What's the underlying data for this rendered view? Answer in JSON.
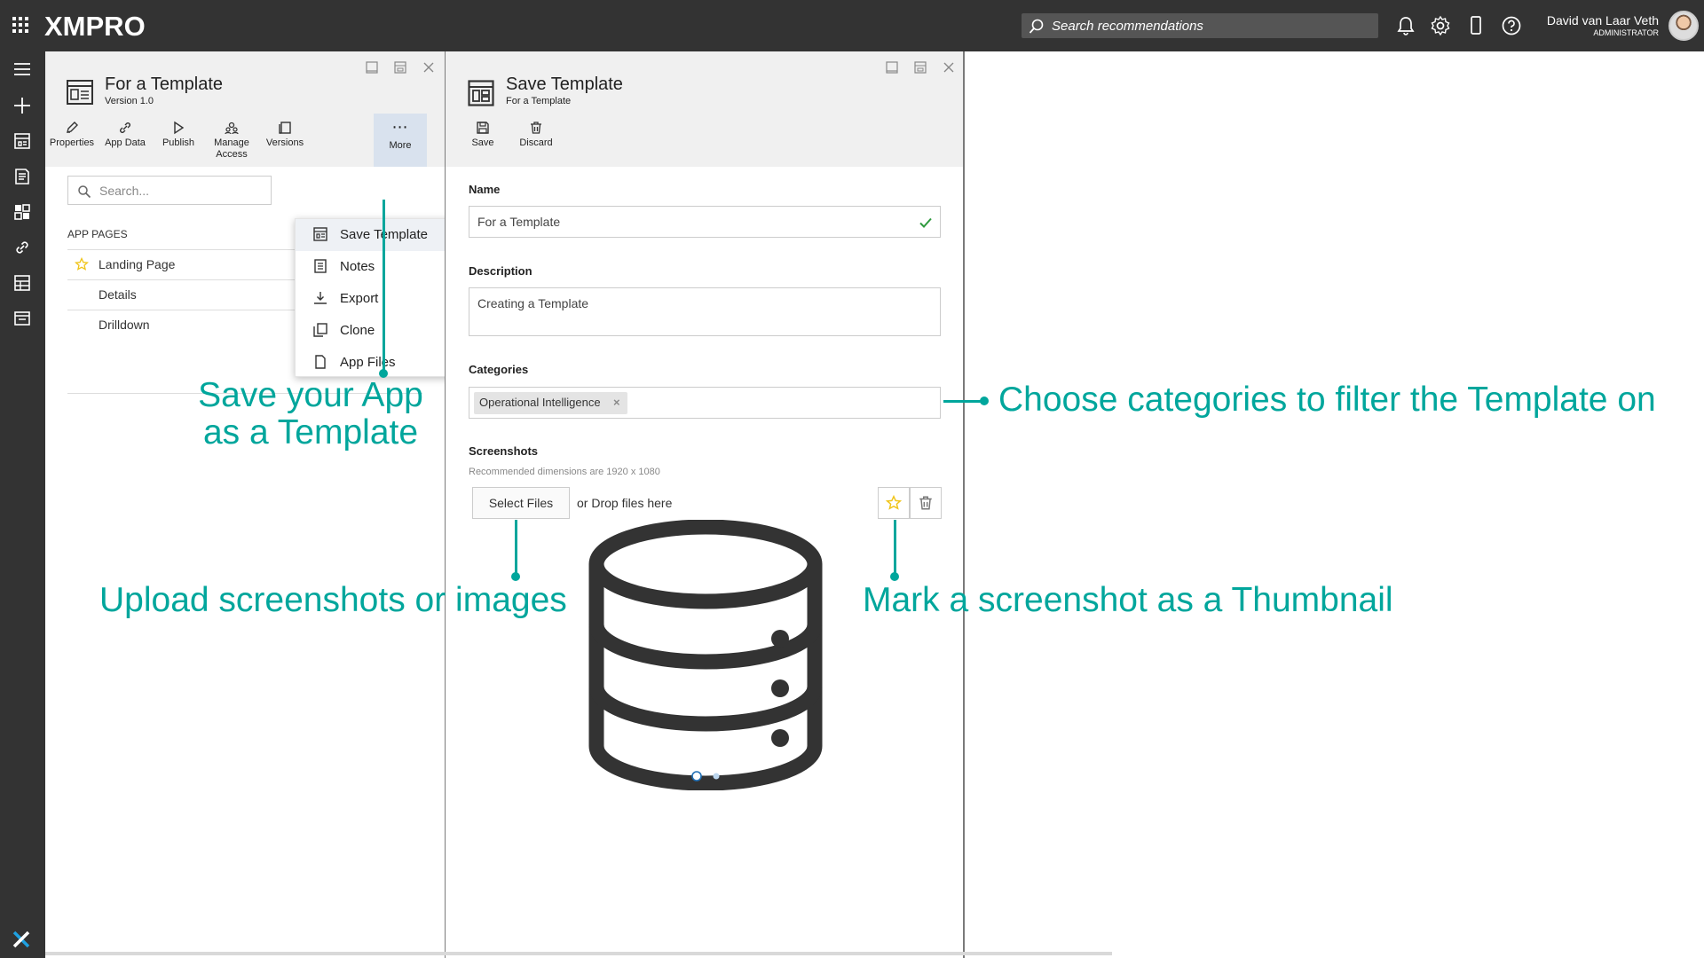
{
  "app": {
    "logo": "XMPRO",
    "search_placeholder": "Search recommendations",
    "user_name": "David van Laar Veth",
    "user_role": "ADMINISTRATOR"
  },
  "rail": {
    "icons": [
      "menu-icon",
      "plus-icon",
      "apps-list-icon",
      "recommendations-icon",
      "dashboard-icon",
      "link-icon",
      "data-stream-icon",
      "template-icon",
      "xmpro-x-icon"
    ]
  },
  "panel_app": {
    "title": "For a Template",
    "version": "Version 1.0",
    "toolbar": {
      "properties": "Properties",
      "app_data": "App Data",
      "publish": "Publish",
      "manage_access_1": "Manage",
      "manage_access_2": "Access",
      "versions": "Versions",
      "more": "More"
    },
    "search_placeholder": "Search...",
    "app_pages_heading": "APP PAGES",
    "pages": [
      {
        "label": "Landing Page",
        "starred": true
      },
      {
        "label": "Details",
        "starred": false
      },
      {
        "label": "Drilldown",
        "starred": false
      }
    ]
  },
  "more_menu": {
    "items": [
      "Save Template",
      "Notes",
      "Export",
      "Clone",
      "App Files"
    ]
  },
  "panel_save": {
    "title": "Save Template",
    "subtitle": "For a Template",
    "toolbar": {
      "save": "Save",
      "discard": "Discard"
    },
    "name_label": "Name",
    "name_value": "For a Template",
    "description_label": "Description",
    "description_value": "Creating a Template",
    "categories_label": "Categories",
    "categories": [
      "Operational Intelligence"
    ],
    "screenshots_label": "Screenshots",
    "screenshots_hint": "Recommended dimensions are 1920 x 1080",
    "select_files": "Select Files",
    "drop_hint": "or Drop files here",
    "carousel_dots": 2
  },
  "annotations": {
    "save_app_line1": "Save your App",
    "save_app_line2": "as a Template",
    "categories": "Choose categories to filter the Template on",
    "upload": "Upload screenshots or images",
    "thumbnail": "Mark a screenshot as a Thumbnail"
  },
  "colors": {
    "topbar": "#333333",
    "accent_teal": "#00a69c",
    "check_green": "#2e9a3e",
    "star_yellow": "#f0c419",
    "more_button_bg": "#d9e2ee"
  }
}
